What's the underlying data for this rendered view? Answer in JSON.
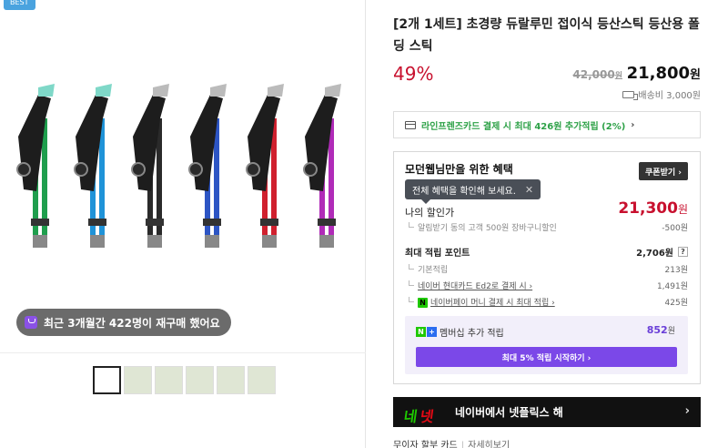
{
  "gallery": {
    "badge": "BEST",
    "purchase_info": "최근 3개월간 422명이 재구매 했어요",
    "pole_colors": [
      "#1f9e4d",
      "#1f93d8",
      "#2a2a2a",
      "#2d55c4",
      "#d0202e",
      "#b02bb8"
    ],
    "thumbnail_count": 6
  },
  "product": {
    "title": "[2개 1세트] 초경량 듀랄루민 접이식 등산스틱 등산용 폴딩 스틱",
    "discount": "49%",
    "original_price": "42,000",
    "original_price_unit": "원",
    "sale_price": "21,800",
    "sale_price_unit": "원",
    "shipping": "배송비 3,000원"
  },
  "card_banner": {
    "prefix": "라인프렌즈카드 결제 시 최대 426원 추가적립 (2%)",
    "chevron": "›"
  },
  "member": {
    "title": "모던웹님만을 위한 혜택",
    "coupon_button": "쿠폰받기 ›",
    "tooltip": "전체 혜택을 확인해 보세요.",
    "tooltip_close": "✕",
    "my_discount_label": "나의 할인가",
    "my_discount_price": "21,300",
    "my_discount_unit": "원",
    "discount_rows": [
      {
        "label": "알림받기 동의 고객 500원 장바구니할인",
        "value": "-500원"
      }
    ],
    "points_label": "최대 적립 포인트",
    "points_value": "2,706원",
    "points_help": "?",
    "point_rows": [
      {
        "label": "기본적립",
        "value": "213원"
      },
      {
        "label": "네이버 현대카드 Ed2로 결제 시 ›",
        "value": "1,491원"
      },
      {
        "label": "네이버페이 머니 결제 시 최대 적립 ›",
        "value": "425원"
      }
    ],
    "membership_label": "멤버십 추가 적립",
    "membership_value": "852",
    "membership_unit": "원",
    "membership_button": "최대 5% 적립 시작하기 ›"
  },
  "netflix_banner": {
    "logo_left": "네",
    "logo_right": "넷",
    "text": "네이버에서 넷플릭스 해",
    "chevron": "›"
  },
  "bottom": {
    "text": "무이자 할부 카드",
    "link": "자세히보기"
  }
}
